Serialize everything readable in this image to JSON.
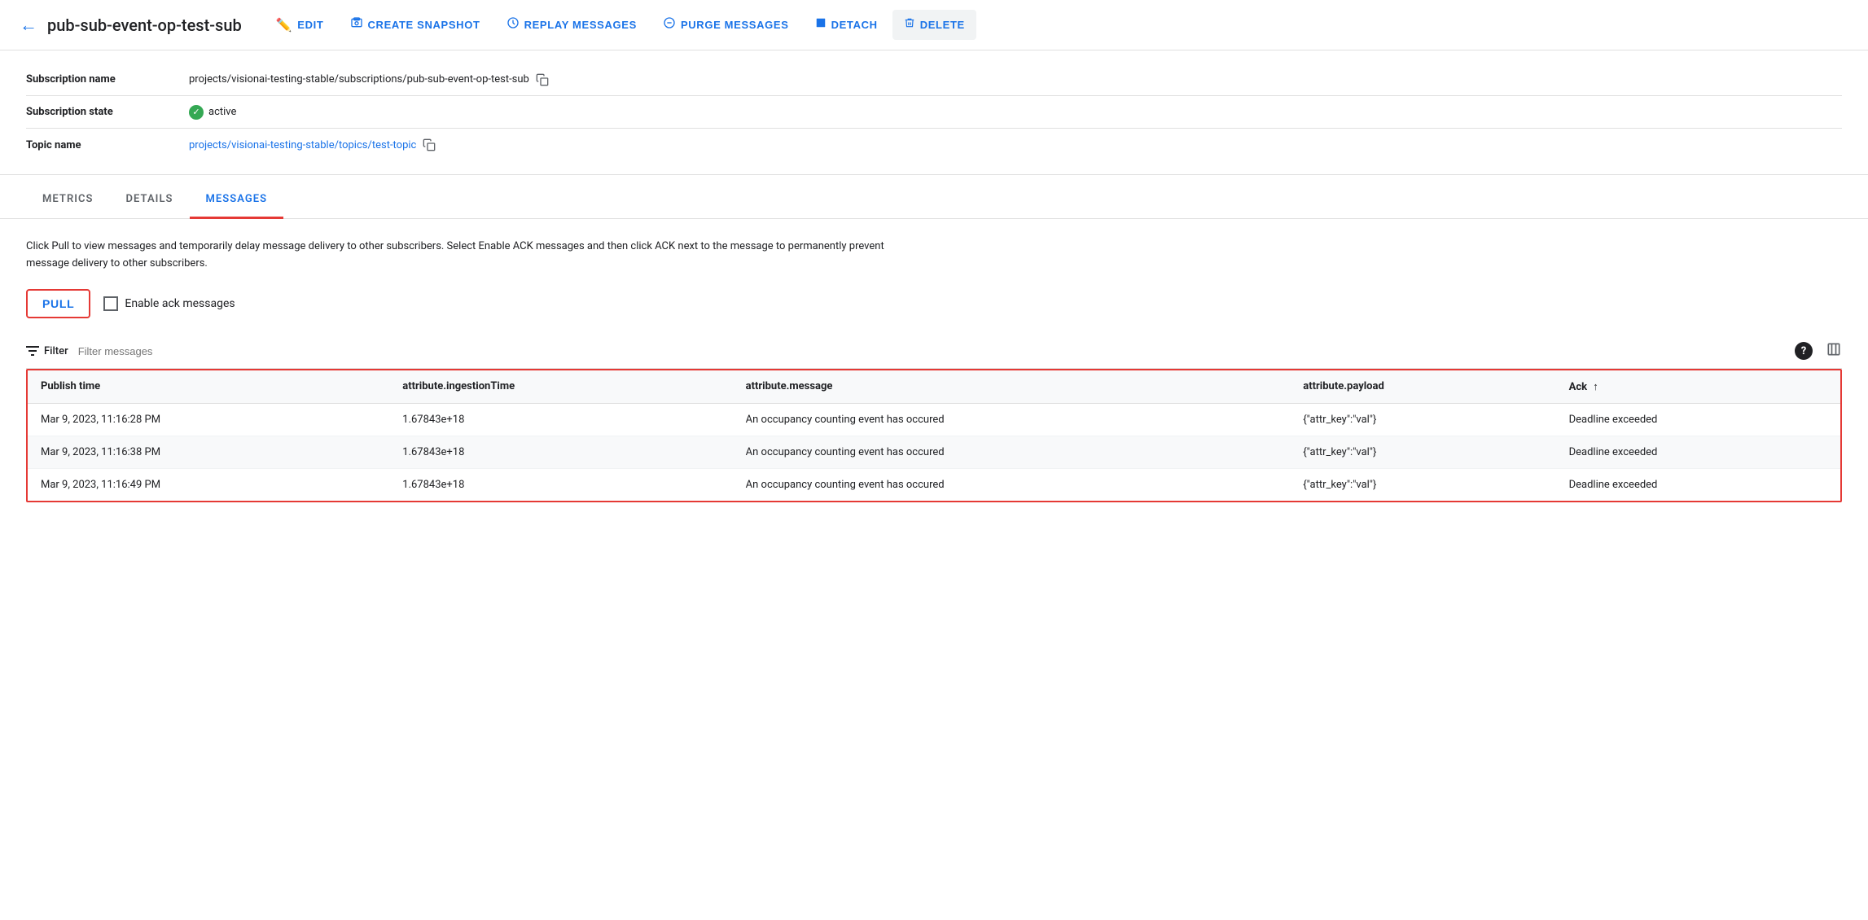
{
  "toolbar": {
    "back_icon": "←",
    "title": "pub-sub-event-op-test-sub",
    "buttons": [
      {
        "id": "edit",
        "label": "EDIT",
        "icon": "✏️"
      },
      {
        "id": "create-snapshot",
        "label": "CREATE SNAPSHOT",
        "icon": "📷"
      },
      {
        "id": "replay-messages",
        "label": "REPLAY MESSAGES",
        "icon": "🕐"
      },
      {
        "id": "purge-messages",
        "label": "PURGE MESSAGES",
        "icon": "⊖"
      },
      {
        "id": "detach",
        "label": "DETACH",
        "icon": "⬛"
      },
      {
        "id": "delete",
        "label": "DELETE",
        "icon": "🗑️"
      }
    ]
  },
  "info": {
    "rows": [
      {
        "label": "Subscription name",
        "value": "projects/visionai-testing-stable/subscriptions/pub-sub-event-op-test-sub",
        "copyable": true,
        "link": false
      },
      {
        "label": "Subscription state",
        "value": "active",
        "status": true,
        "copyable": false,
        "link": false
      },
      {
        "label": "Topic name",
        "value": "projects/visionai-testing-stable/topics/test-topic",
        "copyable": true,
        "link": true
      }
    ]
  },
  "tabs": [
    {
      "id": "metrics",
      "label": "METRICS",
      "active": false
    },
    {
      "id": "details",
      "label": "DETAILS",
      "active": false
    },
    {
      "id": "messages",
      "label": "MESSAGES",
      "active": true
    }
  ],
  "messages": {
    "description": "Click Pull to view messages and temporarily delay message delivery to other subscribers. Select Enable ACK messages and then click ACK next to the message to permanently prevent message delivery to other subscribers.",
    "pull_button": "PULL",
    "ack_label": "Enable ack messages",
    "filter_label": "Filter",
    "filter_placeholder": "Filter messages",
    "help_icon": "?",
    "table": {
      "columns": [
        {
          "id": "publish_time",
          "label": "Publish time",
          "sortable": false
        },
        {
          "id": "ingestion_time",
          "label": "attribute.ingestionTime",
          "sortable": false
        },
        {
          "id": "message",
          "label": "attribute.message",
          "sortable": false
        },
        {
          "id": "payload",
          "label": "attribute.payload",
          "sortable": false
        },
        {
          "id": "ack",
          "label": "Ack",
          "sortable": true
        }
      ],
      "rows": [
        {
          "publish_time": "Mar 9, 2023, 11:16:28 PM",
          "ingestion_time": "1.67843e+18",
          "message": "An occupancy counting event has occured",
          "payload": "{\"attr_key\":\"val\"}",
          "ack": "Deadline exceeded"
        },
        {
          "publish_time": "Mar 9, 2023, 11:16:38 PM",
          "ingestion_time": "1.67843e+18",
          "message": "An occupancy counting event has occured",
          "payload": "{\"attr_key\":\"val\"}",
          "ack": "Deadline exceeded"
        },
        {
          "publish_time": "Mar 9, 2023, 11:16:49 PM",
          "ingestion_time": "1.67843e+18",
          "message": "An occupancy counting event has occured",
          "payload": "{\"attr_key\":\"val\"}",
          "ack": "Deadline exceeded"
        }
      ]
    }
  }
}
